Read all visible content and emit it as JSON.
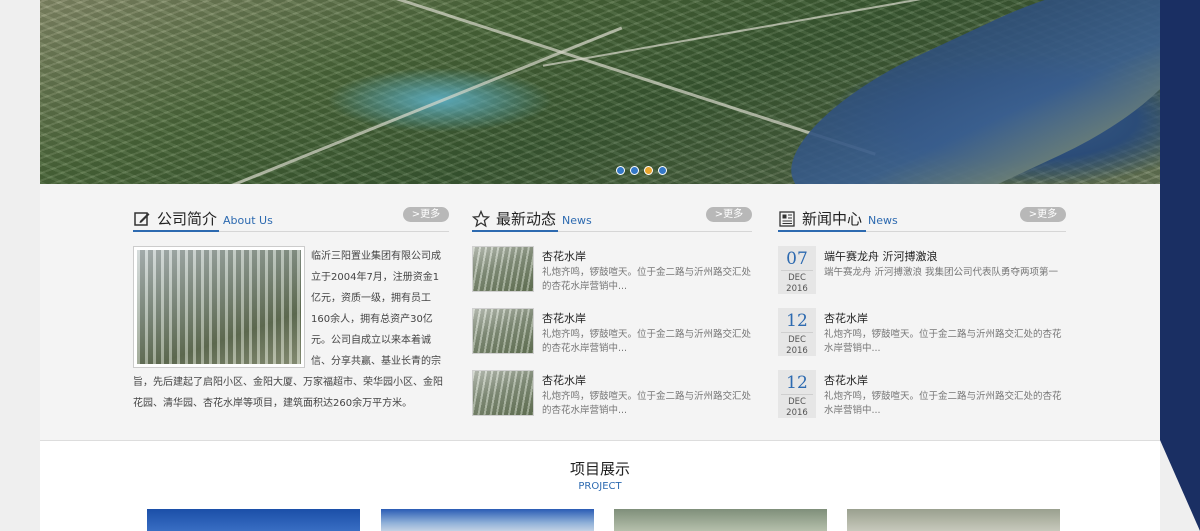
{
  "banner": {
    "slides": 4,
    "active_slide": 3
  },
  "about": {
    "title": "公司简介",
    "title_en": "About Us",
    "more": ">更多",
    "text": "临沂三阳置业集团有限公司成立于2004年7月，注册资金1亿元，资质一级，拥有员工160余人，拥有总资产30亿元。公司自成立以来本着诚信、分享共赢、基业长青的宗旨，先后建起了启阳小区、金阳大厦、万家福超市、荣华园小区、金阳花园、清华园、杏花水岸等项目，建筑面积达260余万平方米。"
  },
  "latest": {
    "title": "最新动态",
    "title_en": "News",
    "more": ">更多",
    "items": [
      {
        "title": "杏花水岸",
        "desc": "礼炮齐鸣，锣鼓喧天。位于金二路与沂州路交汇处的杏花水岸营销中..."
      },
      {
        "title": "杏花水岸",
        "desc": "礼炮齐鸣，锣鼓喧天。位于金二路与沂州路交汇处的杏花水岸营销中..."
      },
      {
        "title": "杏花水岸",
        "desc": "礼炮齐鸣，锣鼓喧天。位于金二路与沂州路交汇处的杏花水岸营销中..."
      }
    ]
  },
  "news_center": {
    "title": "新闻中心",
    "title_en": "News",
    "more": ">更多",
    "items": [
      {
        "day": "07",
        "month": "DEC",
        "year": "2016",
        "title": "端午赛龙舟 沂河搏激浪",
        "desc": "端午赛龙舟 沂河搏激浪 我集团公司代表队勇夺两项第一"
      },
      {
        "day": "12",
        "month": "DEC",
        "year": "2016",
        "title": "杏花水岸",
        "desc": "礼炮齐鸣，锣鼓喧天。位于金二路与沂州路交汇处的杏花水岸营销中..."
      },
      {
        "day": "12",
        "month": "DEC",
        "year": "2016",
        "title": "杏花水岸",
        "desc": "礼炮齐鸣，锣鼓喧天。位于金二路与沂州路交汇处的杏花水岸营销中..."
      }
    ]
  },
  "projects": {
    "title": "项目展示",
    "title_en": "PROJECT"
  },
  "colors": {
    "accent": "#2d6ab0",
    "navy": "#1a2f63",
    "more_bg": "#b8b8b8",
    "active_dot": "#e8a52e"
  },
  "icons": {
    "about": "edit-icon",
    "latest": "star-icon",
    "news_center": "newspaper-icon"
  }
}
